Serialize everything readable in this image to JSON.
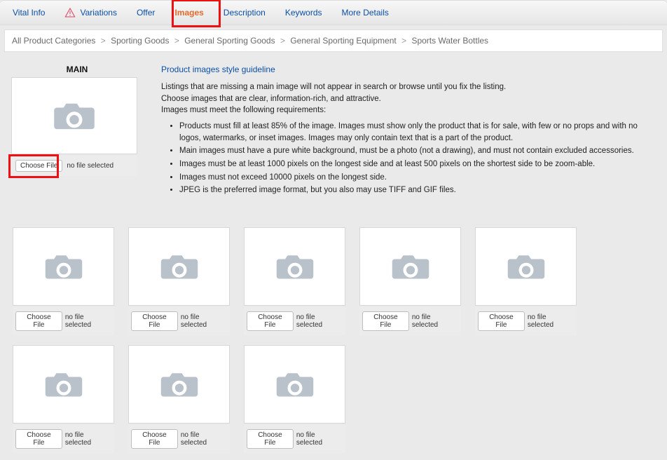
{
  "tabs": {
    "vital": "Vital Info",
    "variations": "Variations",
    "offer": "Offer",
    "images": "Images",
    "description": "Description",
    "keywords": "Keywords",
    "more": "More Details"
  },
  "breadcrumb": {
    "c0": "All Product Categories",
    "c1": "Sporting Goods",
    "c2": "General Sporting Goods",
    "c3": "General Sporting Equipment",
    "c4": "Sports Water Bottles",
    "sep": ">"
  },
  "main": {
    "label": "MAIN",
    "choose": "Choose File",
    "nofile": "no file selected"
  },
  "guide": {
    "title": "Product images style guideline",
    "p1": "Listings that are missing a main image will not appear in search or browse until you fix the listing.",
    "p2": "Choose images that are clear, information-rich, and attractive.",
    "p3": "Images must meet the following requirements:",
    "b1": "Products must fill at least 85% of the image. Images must show only the product that is for sale, with few or no props and with no logos, watermarks, or inset images. Images may only contain text that is a part of the product.",
    "b2": "Main images must have a pure white background, must be a photo (not a drawing), and must not contain excluded accessories.",
    "b3": "Images must be at least 1000 pixels on the longest side and at least 500 pixels on the shortest side to be zoom-able.",
    "b4": "Images must not exceed 10000 pixels on the longest side.",
    "b5": "JPEG is the preferred image format, but you also may use TIFF and GIF files."
  },
  "slot": {
    "choose": "Choose File",
    "nofile": "no file selected"
  }
}
